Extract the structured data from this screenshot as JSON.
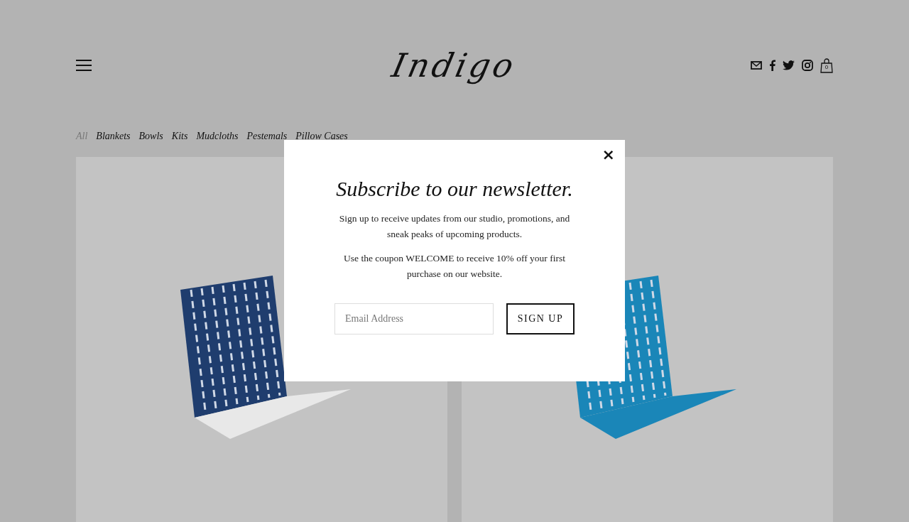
{
  "header": {
    "logo": "Indigo",
    "cart_count": "0"
  },
  "categories": [
    {
      "label": "All",
      "selected": true
    },
    {
      "label": "Blankets",
      "selected": false
    },
    {
      "label": "Bowls",
      "selected": false
    },
    {
      "label": "Kits",
      "selected": false
    },
    {
      "label": "Mudcloths",
      "selected": false
    },
    {
      "label": "Pestemals",
      "selected": false
    },
    {
      "label": "Pillow Cases",
      "selected": false
    }
  ],
  "products": [
    {
      "kind": "dark"
    },
    {
      "kind": "bright"
    }
  ],
  "modal": {
    "title": "Subscribe to our newsletter.",
    "paragraphs": [
      "Sign up to receive updates from our studio, promotions, and sneak peaks of upcoming products.",
      "Use the coupon WELCOME to receive 10% off your first purchase on our website."
    ],
    "email": {
      "placeholder": "Email Address"
    },
    "button": "SIGN UP",
    "close": "×"
  }
}
